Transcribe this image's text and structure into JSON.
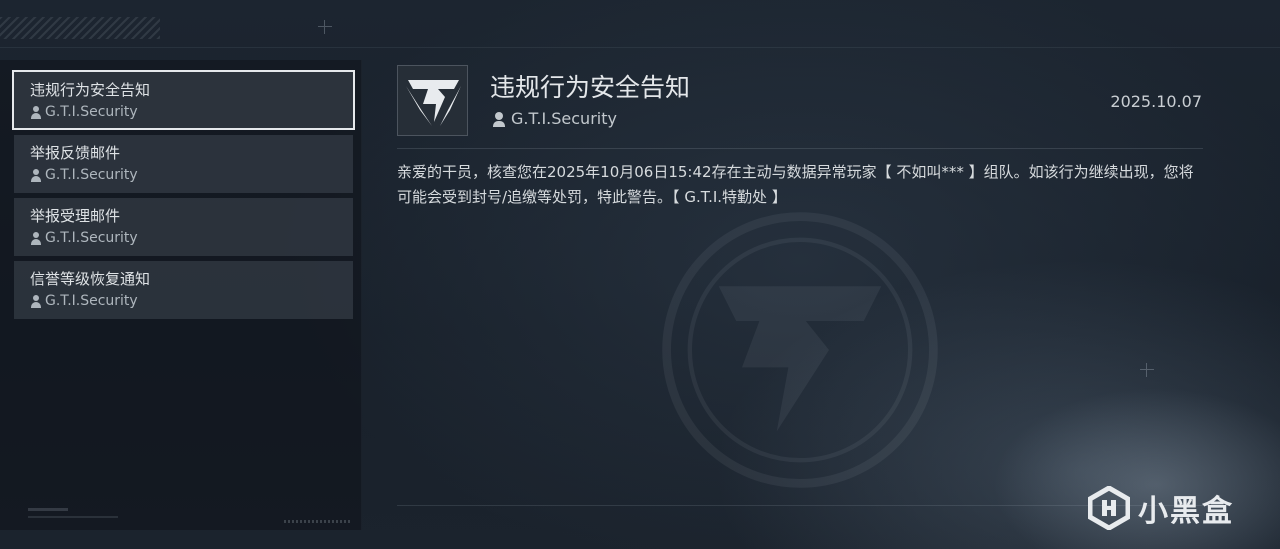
{
  "mail_list": [
    {
      "title": "违规行为安全告知",
      "sender": "G.T.I.Security",
      "selected": true
    },
    {
      "title": "举报反馈邮件",
      "sender": "G.T.I.Security",
      "selected": false
    },
    {
      "title": "举报受理邮件",
      "sender": "G.T.I.Security",
      "selected": false
    },
    {
      "title": "信誉等级恢复通知",
      "sender": "G.T.I.Security",
      "selected": false
    }
  ],
  "detail": {
    "emblem_icon": "gti-lightning-emblem-icon",
    "title": "违规行为安全告知",
    "sender": "G.T.I.Security",
    "date": "2025.10.07",
    "body": "亲爱的干员，核查您在2025年10月06日15:42存在主动与数据异常玩家【 不如叫*** 】组队。如该行为继续出现，您将可能会受到封号/追缴等处罚，特此警告。【 G.T.I.特勤处 】"
  },
  "watermark": {
    "text": "小黑盒",
    "icon": "heybox-logo-icon"
  },
  "colors": {
    "background": "#1a222b",
    "list_item": "#3a424c",
    "selected_border": "#e6e9ec",
    "text_primary": "#e4e7ea",
    "text_secondary": "#aeb6bd"
  }
}
